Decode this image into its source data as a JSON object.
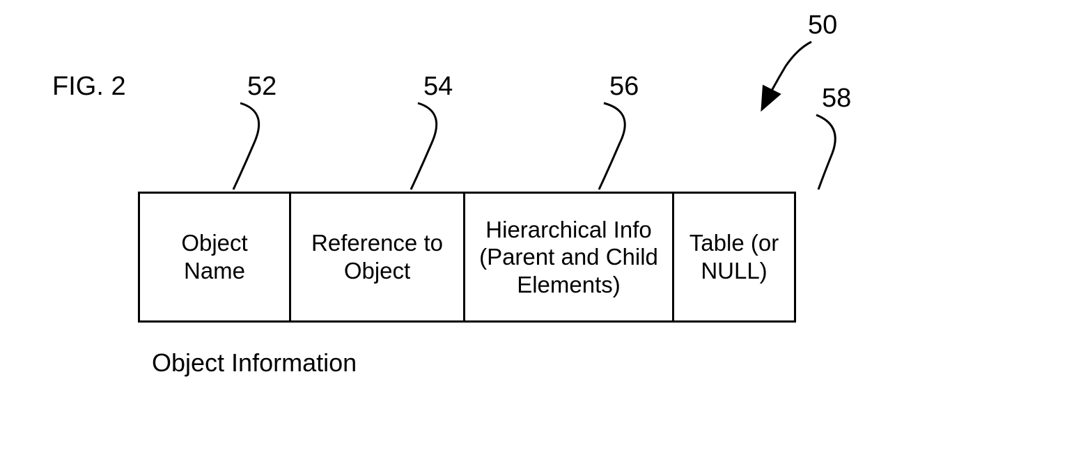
{
  "figure_label": "FIG. 2",
  "leads": {
    "n50": "50",
    "n52": "52",
    "n54": "54",
    "n56": "56",
    "n58": "58"
  },
  "cells": {
    "c1": "Object Name",
    "c2": "Reference to Object",
    "c3": "Hierarchical Info (Parent and Child Elements)",
    "c4": "Table (or NULL)"
  },
  "caption": "Object Information"
}
